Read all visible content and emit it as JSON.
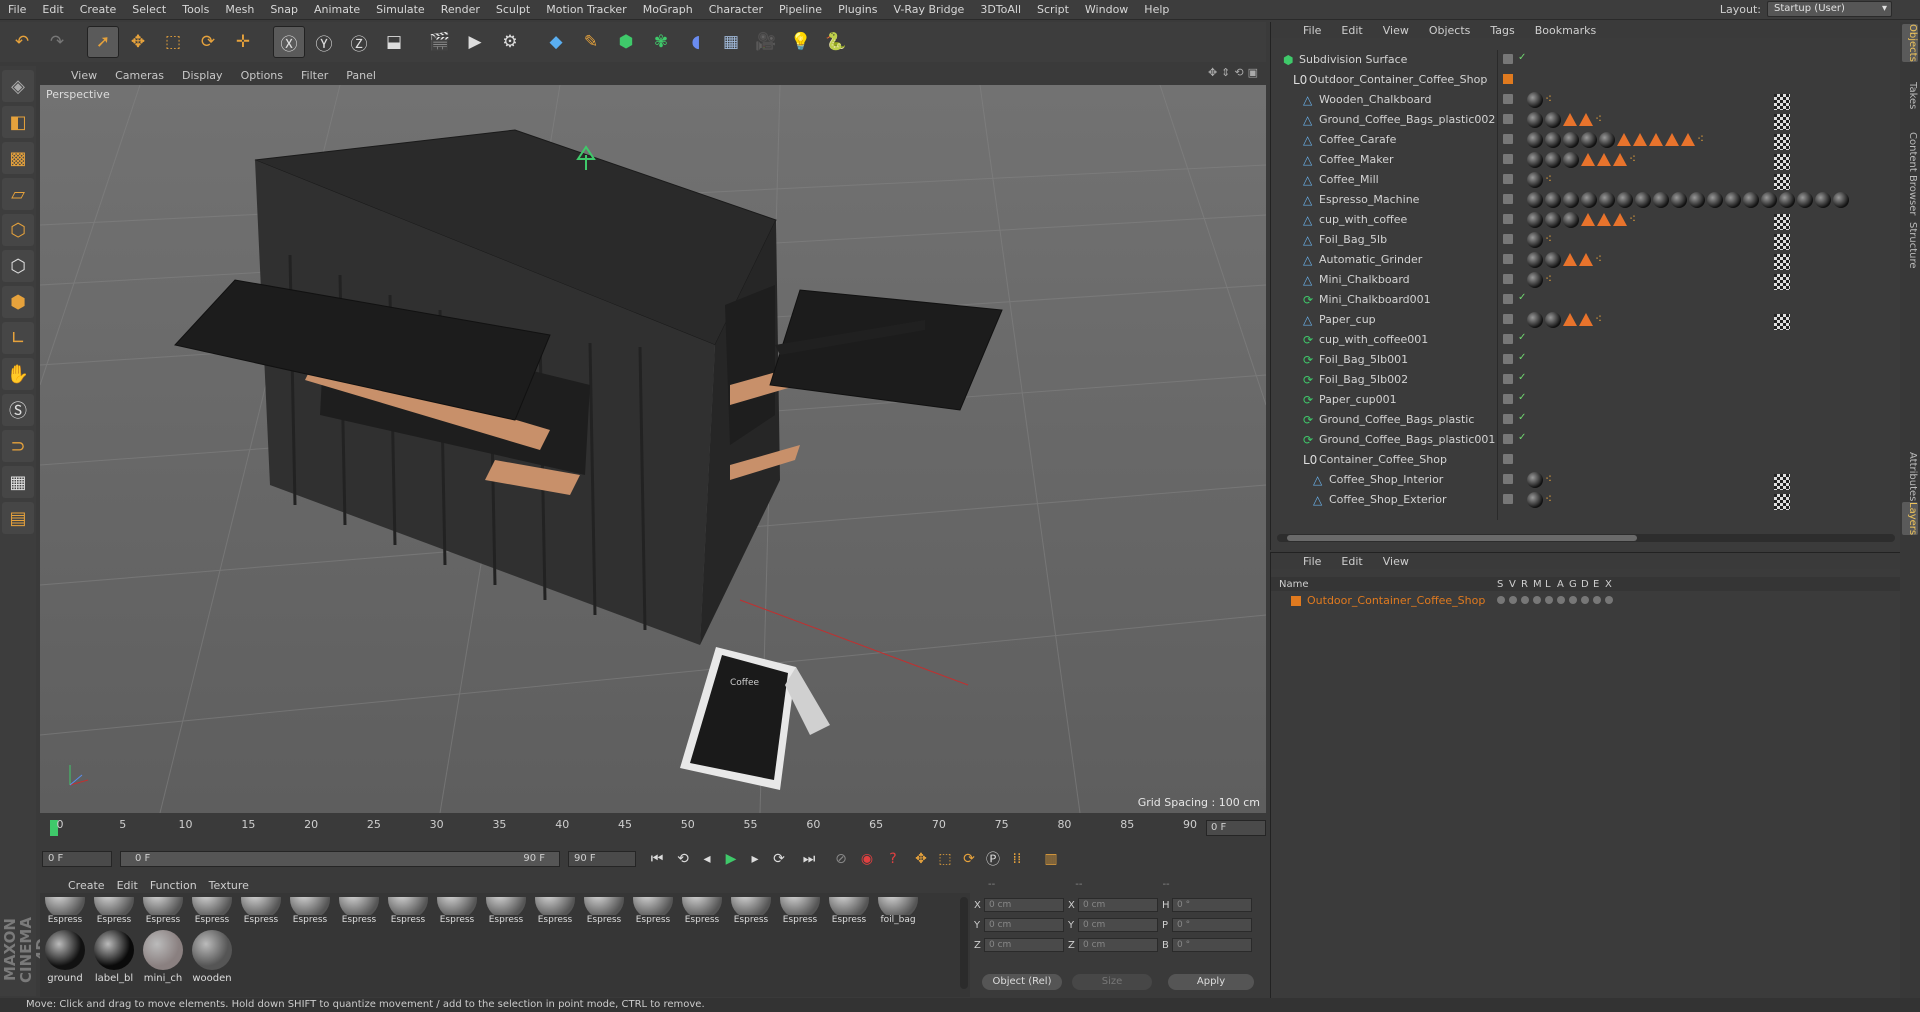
{
  "menubar": {
    "items": [
      "File",
      "Edit",
      "Create",
      "Select",
      "Tools",
      "Mesh",
      "Snap",
      "Animate",
      "Simulate",
      "Render",
      "Sculpt",
      "Motion Tracker",
      "MoGraph",
      "Character",
      "Pipeline",
      "Plugins",
      "V-Ray Bridge",
      "3DToAll",
      "Script",
      "Window",
      "Help"
    ],
    "layout_label": "Layout:",
    "layout_value": "Startup (User)"
  },
  "viewport": {
    "menu": [
      "View",
      "Cameras",
      "Display",
      "Options",
      "Filter",
      "Panel"
    ],
    "label": "Perspective",
    "grid_spacing": "Grid Spacing : 100 cm",
    "sign_text": "Coffee"
  },
  "timeline": {
    "ticks": [
      "0",
      "5",
      "10",
      "15",
      "20",
      "25",
      "30",
      "35",
      "40",
      "45",
      "50",
      "55",
      "60",
      "65",
      "70",
      "75",
      "80",
      "85",
      "90"
    ],
    "current_frame": "0 F",
    "start_field": "0 F",
    "range_start": "0 F",
    "range_end": "90 F",
    "end_field": "90 F"
  },
  "materials": {
    "menu": [
      "Create",
      "Edit",
      "Function",
      "Texture"
    ],
    "top_row": [
      "Espress",
      "Espress",
      "Espress",
      "Espress",
      "Espress",
      "Espress",
      "Espress",
      "Espress",
      "Espress",
      "Espress",
      "Espress",
      "Espress",
      "Espress",
      "Espress",
      "Espress",
      "Espress",
      "Espress",
      "foil_bag"
    ],
    "bottom_row": [
      {
        "label": "ground",
        "color": "#111111"
      },
      {
        "label": "label_bl",
        "color": "#0a0a0a"
      },
      {
        "label": "mini_ch",
        "color": "#8a8080"
      },
      {
        "label": "wooden",
        "color": "#555555"
      }
    ]
  },
  "coords": {
    "header": [
      "--",
      "--",
      "--"
    ],
    "rows": [
      {
        "a": "X",
        "av": "0 cm",
        "b": "X",
        "bv": "0 cm",
        "c": "H",
        "cv": "0 °"
      },
      {
        "a": "Y",
        "av": "0 cm",
        "b": "Y",
        "bv": "0 cm",
        "c": "P",
        "cv": "0 °"
      },
      {
        "a": "Z",
        "av": "0 cm",
        "b": "Z",
        "bv": "0 cm",
        "c": "B",
        "cv": "0 °"
      }
    ],
    "mode": "Object (Rel)",
    "size": "Size",
    "apply": "Apply"
  },
  "objects": {
    "menu": [
      "File",
      "Edit",
      "View",
      "Objects",
      "Tags",
      "Bookmarks"
    ],
    "tree": [
      {
        "name": "Subdivision Surface",
        "depth": 0,
        "kind": "subdiv",
        "check": true,
        "tags": []
      },
      {
        "name": "Outdoor_Container_Coffee_Shop",
        "depth": 1,
        "kind": "null",
        "check": false,
        "tags": []
      },
      {
        "name": "Wooden_Chalkboard",
        "depth": 2,
        "kind": "poly",
        "check": false,
        "tags": [
          "ball",
          "chk",
          "dots"
        ]
      },
      {
        "name": "Ground_Coffee_Bags_plastic002",
        "depth": 2,
        "kind": "poly",
        "check": false,
        "tags": [
          "ball",
          "ball",
          "cone",
          "cone",
          "chk",
          "dots"
        ]
      },
      {
        "name": "Coffee_Carafe",
        "depth": 2,
        "kind": "poly",
        "check": false,
        "tags": [
          "ball",
          "ball",
          "ball",
          "ball",
          "ball",
          "cone",
          "cone",
          "cone",
          "cone",
          "cone",
          "chk",
          "dots"
        ]
      },
      {
        "name": "Coffee_Maker",
        "depth": 2,
        "kind": "poly",
        "check": false,
        "tags": [
          "ball",
          "ball",
          "ball",
          "cone",
          "cone",
          "cone",
          "chk",
          "dots"
        ]
      },
      {
        "name": "Coffee_Mill",
        "depth": 2,
        "kind": "poly",
        "check": false,
        "tags": [
          "ball",
          "chk",
          "dots"
        ]
      },
      {
        "name": "Espresso_Machine",
        "depth": 2,
        "kind": "poly",
        "check": false,
        "tags": [
          "ball",
          "ball",
          "ball",
          "ball",
          "ball",
          "ball",
          "ball",
          "ball",
          "ball",
          "ball",
          "ball",
          "ball",
          "ball",
          "ball",
          "ball",
          "ball",
          "ball",
          "ball"
        ]
      },
      {
        "name": "cup_with_coffee",
        "depth": 2,
        "kind": "poly",
        "check": false,
        "tags": [
          "ball",
          "ball",
          "ball",
          "cone",
          "cone",
          "cone",
          "chk",
          "dots"
        ]
      },
      {
        "name": "Foil_Bag_5lb",
        "depth": 2,
        "kind": "poly",
        "check": false,
        "tags": [
          "ball",
          "chk",
          "dots"
        ]
      },
      {
        "name": "Automatic_Grinder",
        "depth": 2,
        "kind": "poly",
        "check": false,
        "tags": [
          "ball",
          "ball",
          "cone",
          "cone",
          "chk",
          "dots"
        ]
      },
      {
        "name": "Mini_Chalkboard",
        "depth": 2,
        "kind": "poly",
        "check": false,
        "tags": [
          "ball",
          "chk",
          "dots"
        ]
      },
      {
        "name": "Mini_Chalkboard001",
        "depth": 2,
        "kind": "inst",
        "check": true,
        "tags": []
      },
      {
        "name": "Paper_cup",
        "depth": 2,
        "kind": "poly",
        "check": false,
        "tags": [
          "ball",
          "ball",
          "cone",
          "cone",
          "chk",
          "chk",
          "dots"
        ]
      },
      {
        "name": "cup_with_coffee001",
        "depth": 2,
        "kind": "inst",
        "check": true,
        "tags": []
      },
      {
        "name": "Foil_Bag_5lb001",
        "depth": 2,
        "kind": "inst",
        "check": true,
        "tags": []
      },
      {
        "name": "Foil_Bag_5lb002",
        "depth": 2,
        "kind": "inst",
        "check": true,
        "tags": []
      },
      {
        "name": "Paper_cup001",
        "depth": 2,
        "kind": "inst",
        "check": true,
        "tags": []
      },
      {
        "name": "Ground_Coffee_Bags_plastic",
        "depth": 2,
        "kind": "inst",
        "check": true,
        "tags": []
      },
      {
        "name": "Ground_Coffee_Bags_plastic001",
        "depth": 2,
        "kind": "inst",
        "check": true,
        "tags": []
      },
      {
        "name": "Container_Coffee_Shop",
        "depth": 2,
        "kind": "null",
        "check": false,
        "tags": []
      },
      {
        "name": "Coffee_Shop_Interior",
        "depth": 3,
        "kind": "poly",
        "check": false,
        "tags": [
          "ball",
          "chk",
          "chk",
          "chk",
          "dots"
        ]
      },
      {
        "name": "Coffee_Shop_Exterior",
        "depth": 3,
        "kind": "poly",
        "check": false,
        "tags": [
          "ball",
          "chk",
          "chk",
          "chk",
          "dots"
        ]
      }
    ]
  },
  "layers": {
    "menu": [
      "File",
      "Edit",
      "View"
    ],
    "columns": [
      "Name",
      "S",
      "V",
      "R",
      "M",
      "L",
      "A",
      "G",
      "D",
      "E",
      "X"
    ],
    "rows": [
      {
        "name": "Outdoor_Container_Coffee_Shop",
        "color": "#e07a1f"
      }
    ]
  },
  "right_tabs": [
    "Objects",
    "Takes",
    "Content Browser",
    "Structure",
    "Attributes",
    "Layers"
  ],
  "status": "Move: Click and drag to move elements. Hold down SHIFT to quantize movement / add to the selection in point mode, CTRL to remove.",
  "brand": "MAXON CINEMA 4D"
}
